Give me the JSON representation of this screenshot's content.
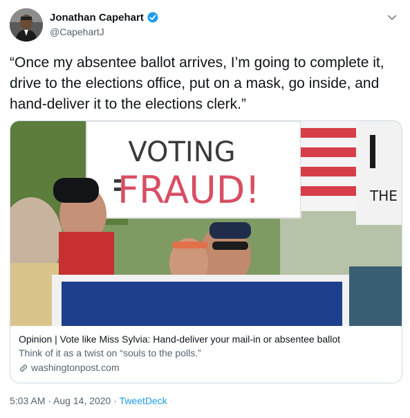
{
  "author": {
    "display_name": "Jonathan Capehart",
    "handle": "@CapehartJ",
    "verified": true
  },
  "tweet": {
    "text": "“Once my absentee ballot arrives, I’m going to complete it, drive to the elections office, put on a mask, go inside, and hand-deliver it to the elections clerk.”"
  },
  "card": {
    "image_sign_text": {
      "line1": "VOTING",
      "line2": "FRAUD!",
      "side": "THE"
    },
    "title": "Opinion | Vote like Miss Sylvia: Hand-deliver your mail-in or absentee ballot",
    "description": "Think of it as a twist on “souls to the polls.”",
    "domain": "washingtonpost.com"
  },
  "footer": {
    "time": "5:03 AM",
    "separator1": " · ",
    "date": "Aug 14, 2020",
    "separator2": " · ",
    "source": "TweetDeck"
  },
  "colors": {
    "verified_badge": "#1d9bf0",
    "link_blue": "#1d9bf0",
    "secondary_text": "#536471",
    "border": "#cfd9de"
  },
  "icons": {
    "verified": "verified-badge-icon",
    "caret": "chevron-down-icon",
    "link": "link-icon"
  }
}
